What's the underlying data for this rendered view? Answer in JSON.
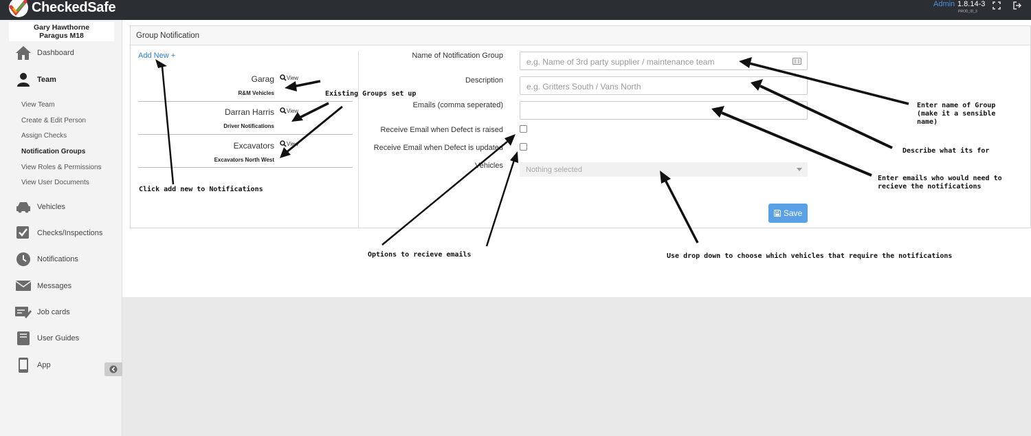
{
  "app": {
    "logo_text": "CheckedSafe",
    "admin_label": "Admin",
    "version": "1.8.14-3",
    "env": "PROD_ID_3",
    "icons": [
      "fullscreen-icon",
      "logout-icon"
    ]
  },
  "user": {
    "name": "Gary Hawthorne",
    "company": "Paragus M18"
  },
  "sidebar": {
    "items": [
      {
        "label": "Dashboard",
        "icon": "home-icon"
      },
      {
        "label": "Team",
        "icon": "person-icon"
      },
      {
        "label": "Vehicles",
        "icon": "car-icon"
      },
      {
        "label": "Checks/Inspections",
        "icon": "checkbox-icon"
      },
      {
        "label": "Notifications",
        "icon": "clock-icon"
      },
      {
        "label": "Messages",
        "icon": "envelope-icon"
      },
      {
        "label": "Job cards",
        "icon": "edit-card-icon"
      },
      {
        "label": "User Guides",
        "icon": "book-icon"
      },
      {
        "label": "App",
        "icon": "mobile-icon"
      }
    ],
    "team_sub": [
      "View Team",
      "Create & Edit Person",
      "Assign Checks",
      "Notification Groups",
      "View Roles & Permissions",
      "View User Documents"
    ]
  },
  "panel": {
    "title": "Group Notification",
    "add_new": "Add New +",
    "view_label": "View",
    "groups": [
      {
        "name": "Garag",
        "sub": "R&M Vehicles"
      },
      {
        "name": "Darran Harris",
        "sub": "Driver Notifications"
      },
      {
        "name": "Excavators",
        "sub": "Excavators North West"
      }
    ]
  },
  "form": {
    "name_label": "Name of Notification Group",
    "name_placeholder": "e.g. Name of 3rd party supplier / maintenance team",
    "desc_label": "Description",
    "desc_placeholder": "e.g. Gritters South / Vans North",
    "emails_label": "Emails (comma seperated)",
    "emails_value": "",
    "raised_label": "Receive Email when Defect is raised",
    "updated_label": "Receive Email when Defect is updated",
    "vehicles_label": "Vehicles",
    "vehicles_value": "Nothing selected",
    "save_label": "Save"
  },
  "annotations": {
    "existing": "Existing Groups set up",
    "click_add": "Click add new to Notifications",
    "enter_name_1": "Enter name of Group",
    "enter_name_2": "(make it a sensible",
    "enter_name_3": "name)",
    "describe": "Describe what its for",
    "emails_1": "Enter emails who would need to",
    "emails_2": "recieve the notifications",
    "options": "Options to recieve emails",
    "dropdown": "Use drop down to choose which vehicles that require the notifications"
  },
  "colors": {
    "topbar": "#2b2f33",
    "accent": "#2a7ae2",
    "save": "#5aa0e6"
  }
}
